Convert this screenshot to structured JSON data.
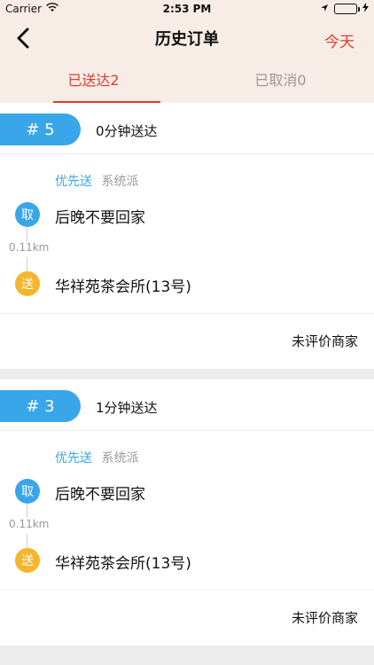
{
  "status_bar": {
    "carrier": "Carrier",
    "time": "2:53 PM"
  },
  "nav": {
    "title": "历史订单",
    "right_label": "今天"
  },
  "tabs": [
    {
      "label": "已送达2",
      "active": true
    },
    {
      "label": "已取消0",
      "active": false
    }
  ],
  "orders": [
    {
      "badge": "# 5",
      "deliver_time": "0分钟送达",
      "tag_priority": "优先送",
      "tag_system": "系统派",
      "pickup_icon": "取",
      "pickup_address": "后晚不要回家",
      "distance": "0.11km",
      "drop_icon": "送",
      "drop_address": "华祥苑茶会所(13号)",
      "rate_label": "未评价商家"
    },
    {
      "badge": "# 3",
      "deliver_time": "1分钟送达",
      "tag_priority": "优先送",
      "tag_system": "系统派",
      "pickup_icon": "取",
      "pickup_address": "后晚不要回家",
      "distance": "0.11km",
      "drop_icon": "送",
      "drop_address": "华祥苑茶会所(13号)",
      "rate_label": "未评价商家"
    }
  ],
  "colors": {
    "accent_red": "#e03a2f",
    "badge_blue": "#3aa6ea",
    "drop_yellow": "#f6b52a",
    "header_bg": "#f7ede6"
  }
}
